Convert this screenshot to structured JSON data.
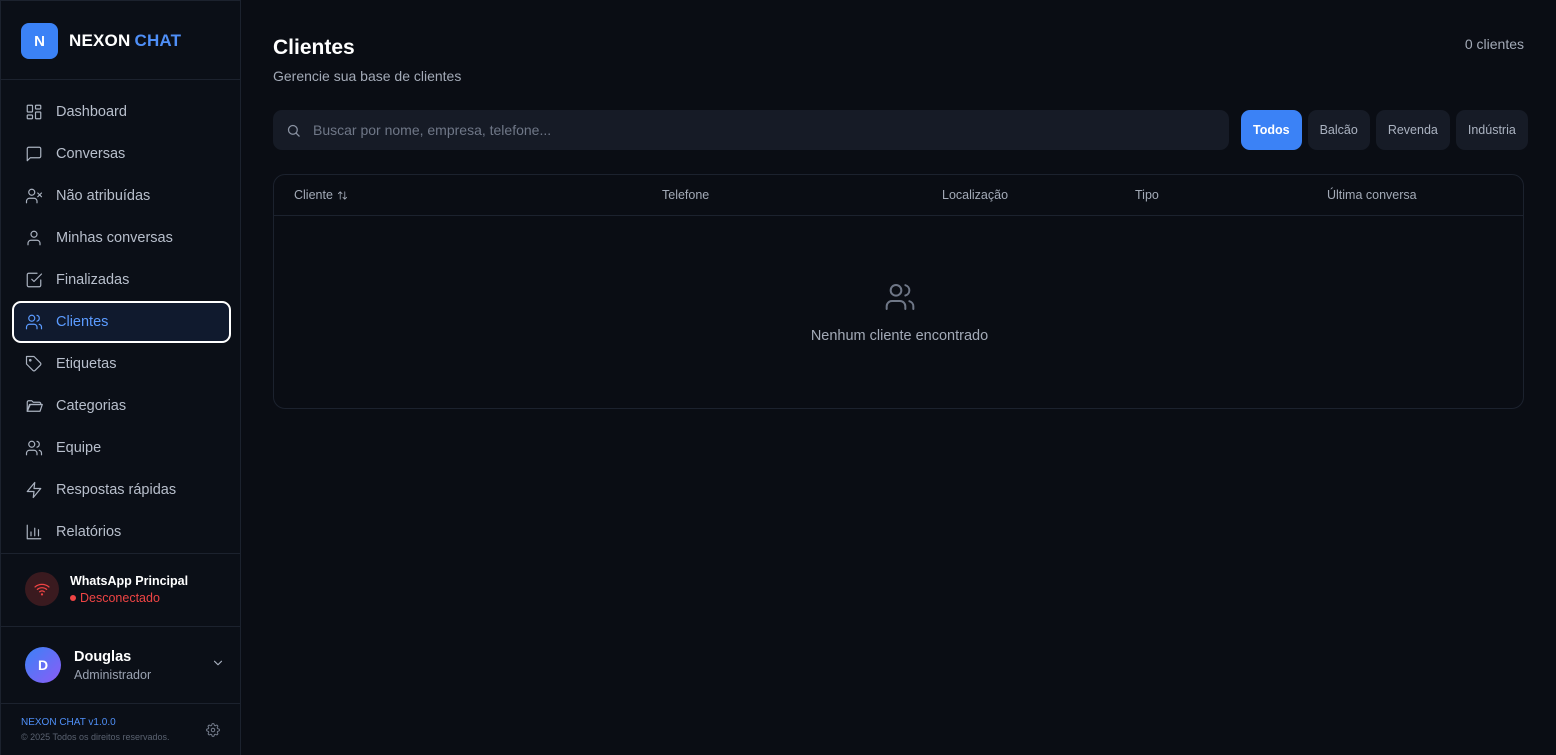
{
  "brand": {
    "logo_letter": "N",
    "name_part1": "NEXON",
    "name_part2": "CHAT"
  },
  "sidebar": {
    "items": [
      {
        "label": "Dashboard",
        "icon": "dashboard-icon"
      },
      {
        "label": "Conversas",
        "icon": "message-icon"
      },
      {
        "label": "Não atribuídas",
        "icon": "user-x-icon"
      },
      {
        "label": "Minhas conversas",
        "icon": "user-icon"
      },
      {
        "label": "Finalizadas",
        "icon": "check-square-icon"
      },
      {
        "label": "Clientes",
        "icon": "users-icon",
        "active": true
      },
      {
        "label": "Etiquetas",
        "icon": "tag-icon"
      },
      {
        "label": "Categorias",
        "icon": "folder-icon"
      },
      {
        "label": "Equipe",
        "icon": "team-icon"
      },
      {
        "label": "Respostas rápidas",
        "icon": "zap-icon"
      },
      {
        "label": "Relatórios",
        "icon": "bar-chart-icon"
      }
    ]
  },
  "whatsapp": {
    "name": "WhatsApp Principal",
    "status": "Desconectado",
    "status_color": "#ef4444"
  },
  "user": {
    "initial": "D",
    "name": "Douglas",
    "role": "Administrador"
  },
  "footer": {
    "version": "NEXON CHAT v1.0.0",
    "copyright": "© 2025 Todos os direitos reservados."
  },
  "page": {
    "title": "Clientes",
    "subtitle": "Gerencie sua base de clientes",
    "count": "0 clientes"
  },
  "search": {
    "placeholder": "Buscar por nome, empresa, telefone..."
  },
  "filters": [
    {
      "label": "Todos",
      "active": true
    },
    {
      "label": "Balcão"
    },
    {
      "label": "Revenda"
    },
    {
      "label": "Indústria"
    }
  ],
  "table": {
    "columns": [
      "Cliente",
      "Telefone",
      "Localização",
      "Tipo",
      "Última conversa"
    ],
    "empty_text": "Nenhum cliente encontrado"
  },
  "colors": {
    "accent": "#3b82f6",
    "background": "#0a0d14",
    "danger": "#ef4444"
  }
}
